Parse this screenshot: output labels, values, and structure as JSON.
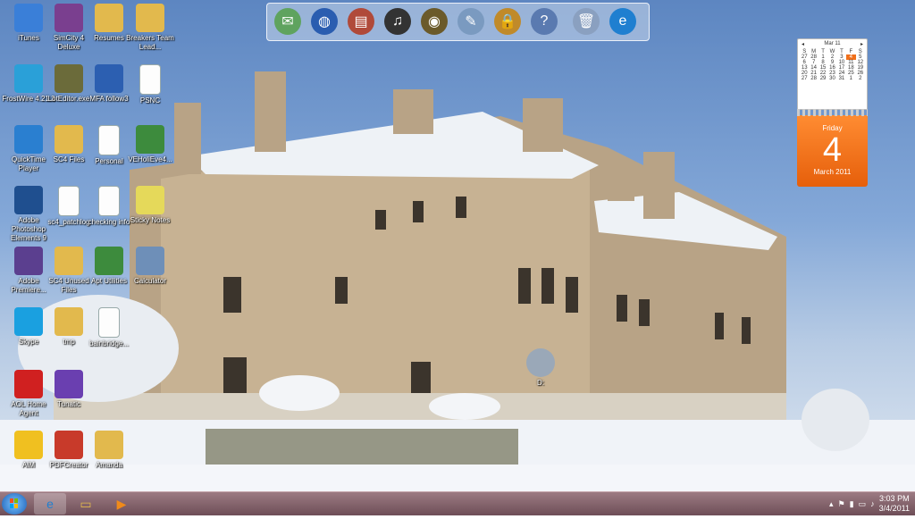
{
  "desktop_icons": [
    {
      "label": "iTunes",
      "icon": "itunes-icon",
      "color": "#3a7fd8"
    },
    {
      "label": "SimCity 4 Deluxe",
      "icon": "simcity-icon",
      "color": "#7a3f8f"
    },
    {
      "label": "Resumes",
      "icon": "folder-icon",
      "color": "#e2b94d"
    },
    {
      "label": "Breakers Team Lead...",
      "icon": "folder-icon",
      "color": "#e2b94d"
    },
    {
      "label": "FrostWire 4.21.3",
      "icon": "frostwire-icon",
      "color": "#2aa0d8"
    },
    {
      "label": "LotEditor.exe",
      "icon": "app-icon",
      "color": "#6b6b3a"
    },
    {
      "label": "MFA follow3",
      "icon": "word-doc-icon",
      "color": "#2c5fb1"
    },
    {
      "label": "PSNC",
      "icon": "document-icon",
      "color": "#fdfdfd"
    },
    {
      "label": "QuickTime Player",
      "icon": "quicktime-icon",
      "color": "#2a7fd0"
    },
    {
      "label": "SC4 Files",
      "icon": "folder-icon",
      "color": "#e2b94d"
    },
    {
      "label": "Personal",
      "icon": "document-icon",
      "color": "#fdfdfd"
    },
    {
      "label": "VEHoliEve4...",
      "icon": "excel-doc-icon",
      "color": "#3d8b3d"
    },
    {
      "label": "Adobe Photoshop Elements 9",
      "icon": "photoshop-icon",
      "color": "#1f4f8f"
    },
    {
      "label": "sc4_patchlog",
      "icon": "document-icon",
      "color": "#fdfdfd"
    },
    {
      "label": "checking info",
      "icon": "document-icon",
      "color": "#fdfdfd"
    },
    {
      "label": "Sticky Notes",
      "icon": "sticky-notes-icon",
      "color": "#e5d95a"
    },
    {
      "label": "Adobe Premiere...",
      "icon": "premiere-icon",
      "color": "#5b3f8f"
    },
    {
      "label": "SC4 Unused Files",
      "icon": "folder-icon",
      "color": "#e2b94d"
    },
    {
      "label": "Apt Utilities",
      "icon": "excel-doc-icon",
      "color": "#3d8b3d"
    },
    {
      "label": "Calculator",
      "icon": "calculator-icon",
      "color": "#6e8fb8"
    },
    {
      "label": "Skype",
      "icon": "skype-icon",
      "color": "#1aa0e0"
    },
    {
      "label": "tmp",
      "icon": "folder-icon",
      "color": "#e2b94d"
    },
    {
      "label": "bainbridge...",
      "icon": "document-icon",
      "color": "#fdfdfd"
    },
    {
      "label": "AOL Home Agent",
      "icon": "aol-agent-icon",
      "color": "#d02020"
    },
    {
      "label": "Tunatic",
      "icon": "tunatic-icon",
      "color": "#6a3fb0"
    },
    {
      "label": "AIM",
      "icon": "aim-icon",
      "color": "#f0c020"
    },
    {
      "label": "PDFCreator",
      "icon": "pdfcreator-icon",
      "color": "#c83a2a"
    },
    {
      "label": "Amanda",
      "icon": "folder-icon",
      "color": "#e2b94d"
    },
    {
      "label": "D:",
      "icon": "disc-drive-icon",
      "color": "#9aa8b8"
    }
  ],
  "dock": [
    {
      "icon": "mail-icon",
      "color": "#5fa35f",
      "glyph": "✉"
    },
    {
      "icon": "globe-icon",
      "color": "#2a5db0",
      "glyph": "◍"
    },
    {
      "icon": "books-icon",
      "color": "#b04a3a",
      "glyph": "▤"
    },
    {
      "icon": "headphones-icon",
      "color": "#333333",
      "glyph": "♫"
    },
    {
      "icon": "film-reel-icon",
      "color": "#6b5a2a",
      "glyph": "◉"
    },
    {
      "icon": "notepad-icon",
      "color": "#7a9ac0",
      "glyph": "✎"
    },
    {
      "icon": "lock-icon",
      "color": "#c08a2a",
      "glyph": "🔒"
    },
    {
      "icon": "help-icon",
      "color": "#5a7ab0",
      "glyph": "?"
    },
    {
      "icon": "recycle-bin-icon",
      "color": "#8aa0c0",
      "glyph": "🗑"
    },
    {
      "icon": "internet-explorer-icon",
      "color": "#1f7fd0",
      "glyph": "e"
    }
  ],
  "calendar": {
    "month_header": "Mar 11",
    "weekdays": [
      "S",
      "M",
      "T",
      "W",
      "T",
      "F",
      "S"
    ],
    "days": [
      "27",
      "28",
      "1",
      "2",
      "3",
      "4",
      "5",
      "6",
      "7",
      "8",
      "9",
      "10",
      "11",
      "12",
      "13",
      "14",
      "15",
      "16",
      "17",
      "18",
      "19",
      "20",
      "21",
      "22",
      "23",
      "24",
      "25",
      "26",
      "27",
      "28",
      "29",
      "30",
      "31",
      "1",
      "2"
    ],
    "today": "4",
    "big_day_name": "Friday",
    "big_day_number": "4",
    "big_month_year": "March 2011"
  },
  "taskbar": {
    "pinned": [
      {
        "icon": "internet-explorer-icon",
        "glyph": "e",
        "color": "#1f7fd0"
      },
      {
        "icon": "file-explorer-icon",
        "glyph": "▭",
        "color": "#e2b94d"
      },
      {
        "icon": "media-player-icon",
        "glyph": "▶",
        "color": "#f08a1a"
      }
    ],
    "tray_icons": [
      "show-hidden-icon",
      "flag-icon",
      "network-icon",
      "battery-icon",
      "volume-icon"
    ],
    "time": "3:03 PM",
    "date": "3/4/2011"
  }
}
